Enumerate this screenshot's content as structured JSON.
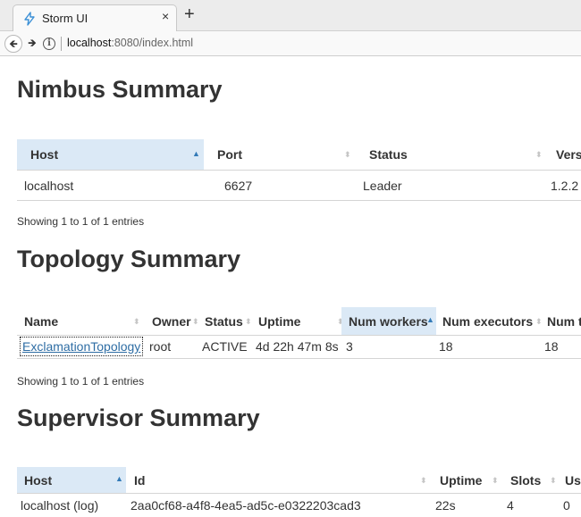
{
  "browser": {
    "tab_title": "Storm UI",
    "tab_close": "×",
    "new_tab": "+",
    "url_host": "localhost",
    "url_rest": ":8080/index.html"
  },
  "nimbus": {
    "title": "Nimbus Summary",
    "headers": [
      "Host",
      "Port",
      "Status",
      "Vers"
    ],
    "row": [
      "localhost",
      "6627",
      "Leader",
      "1.2.2"
    ],
    "info": "Showing 1 to 1 of 1 entries"
  },
  "topology": {
    "title": "Topology Summary",
    "headers": [
      "Name",
      "Owner",
      "Status",
      "Uptime",
      "Num workers",
      "Num executors",
      "Num t"
    ],
    "row": [
      "ExclamationTopology",
      "root",
      "ACTIVE",
      "4d 22h 47m 8s",
      "3",
      "18",
      "18"
    ],
    "info": "Showing 1 to 1 of 1 entries"
  },
  "supervisor": {
    "title": "Supervisor Summary",
    "headers": [
      "Host",
      "Id",
      "Uptime",
      "Slots",
      "Us"
    ],
    "row": [
      "localhost (log)",
      "2aa0cf68-a4f8-4ea5-ad5c-e0322203cad3",
      "22s",
      "4",
      "0"
    ]
  },
  "colors": {
    "sorted_header": "#dbe9f6",
    "link": "#2e6da4",
    "sort_active": "#337ab7"
  }
}
